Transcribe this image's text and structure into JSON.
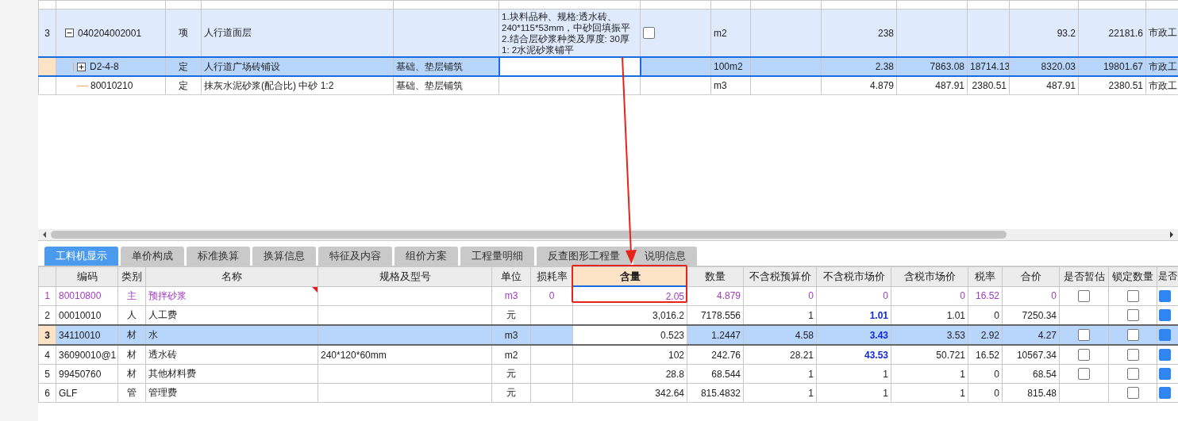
{
  "top_table": {
    "rows": [
      {
        "row_number": "3",
        "code": "040204002001",
        "expanded": true,
        "selected": false,
        "column_3": "项",
        "column_4": "人行道面层",
        "column_6": "1.块料品种、规格:透水砖、\n240*115*53mm，中砂回填振平\n2.结合层砂浆种类及厚度: 30厚\n1: 2水泥砂浆铺平",
        "column_7": {
          "checked": false
        },
        "column_8": "m2",
        "column_10": "238",
        "column_13": "93.2",
        "column_14": "22181.6",
        "column_15": "市政工",
        "children": [
          {
            "code": "D2-4-8",
            "expanded": false,
            "selected": true,
            "column_3": "定",
            "column_4": "人行道广场砖铺设",
            "column_5": "基础、垫层铺筑",
            "column_8": "100m2",
            "column_10": "2.38",
            "column_11": "7863.08",
            "column_12": "18714.13",
            "column_13": "8320.03",
            "column_14": "19801.67",
            "column_15": "市政工"
          },
          {
            "code": "80010210",
            "selected": false,
            "column_3": "定",
            "column_4": "抹灰水泥砂浆(配合比) 中砂 1:2",
            "column_5": "基础、垫层铺筑",
            "column_8": "m3",
            "column_10": "4.879",
            "column_11": "487.91",
            "column_12": "2380.51",
            "column_13": "487.91",
            "column_14": "2380.51",
            "column_15": "市政工"
          }
        ]
      }
    ]
  },
  "tabs": [
    {
      "label": "工料机显示",
      "selected": true
    },
    {
      "label": "单价构成",
      "selected": false
    },
    {
      "label": "标准换算",
      "selected": false
    },
    {
      "label": "换算信息",
      "selected": false
    },
    {
      "label": "特征及内容",
      "selected": false
    },
    {
      "label": "组价方案",
      "selected": false
    },
    {
      "label": "工程量明细",
      "selected": false
    },
    {
      "label": "反查图形工程量",
      "selected": false
    },
    {
      "label": "说明信息",
      "selected": false
    }
  ],
  "resource_table": {
    "columns": [
      {
        "label": "编码",
        "active": false
      },
      {
        "label": "类别",
        "active": false
      },
      {
        "label": "名称",
        "active": false
      },
      {
        "label": "规格及型号",
        "active": false
      },
      {
        "label": "单位",
        "active": false
      },
      {
        "label": "损耗率",
        "active": false
      },
      {
        "label": "含量",
        "active": true
      },
      {
        "label": "数量",
        "active": false
      },
      {
        "label": "不含税预算价",
        "active": false
      },
      {
        "label": "不含税市场价",
        "active": false
      },
      {
        "label": "含税市场价",
        "active": false
      },
      {
        "label": "税率",
        "active": false
      },
      {
        "label": "合价",
        "active": false
      },
      {
        "label": "是否暂估",
        "active": false
      },
      {
        "label": "锁定数量",
        "active": false
      },
      {
        "label": "是否",
        "active": false
      }
    ],
    "rows": [
      {
        "row_number": "1",
        "kind": "main",
        "selected": false,
        "note_marker": true,
        "market_price_changed": false,
        "cells": [
          "80010800",
          "主",
          "预拌砂浆",
          null,
          "m3",
          "0",
          "2.05",
          "4.879",
          "0",
          "0",
          "0",
          "16.52",
          "0"
        ],
        "estimate": {
          "checked": false
        },
        "lock": {
          "checked": false
        },
        "last": {
          "checked": true
        }
      },
      {
        "row_number": "2",
        "kind": "normal",
        "selected": false,
        "note_marker": false,
        "market_price_changed": true,
        "cells": [
          "00010010",
          "人",
          "人工费",
          null,
          "元",
          null,
          "3,016.2",
          "7178.556",
          "1",
          "1.01",
          "1.01",
          "0",
          "7250.34"
        ],
        "lock": {
          "checked": false
        },
        "last": {
          "checked": true
        }
      },
      {
        "row_number": "3",
        "kind": "normal",
        "selected": true,
        "note_marker": false,
        "market_price_changed": true,
        "cells": [
          "34110010",
          "材",
          "水",
          null,
          "m3",
          null,
          "0.523",
          "1.2447",
          "4.58",
          "3.43",
          "3.53",
          "2.92",
          "4.27"
        ],
        "estimate": {
          "checked": false
        },
        "lock": {
          "checked": false
        },
        "last": {
          "checked": true
        }
      },
      {
        "row_number": "4",
        "kind": "normal",
        "selected": false,
        "note_marker": false,
        "market_price_changed": true,
        "cells": [
          "36090010@1",
          "材",
          "透水砖",
          "240*120*60mm",
          "m2",
          null,
          "102",
          "242.76",
          "28.21",
          "43.53",
          "50.721",
          "16.52",
          "10567.34"
        ],
        "estimate": {
          "checked": false
        },
        "lock": {
          "checked": false
        },
        "last": {
          "checked": true
        }
      },
      {
        "row_number": "5",
        "kind": "normal",
        "selected": false,
        "note_marker": false,
        "market_price_changed": false,
        "cells": [
          "99450760",
          "材",
          "其他材料费",
          null,
          "元",
          null,
          "28.8",
          "68.544",
          "1",
          "1",
          "1",
          "0",
          "68.54"
        ],
        "estimate": {
          "checked": false
        },
        "lock": {
          "checked": false
        },
        "last": {
          "checked": true
        }
      },
      {
        "row_number": "6",
        "kind": "normal",
        "selected": false,
        "note_marker": false,
        "market_price_changed": false,
        "cells": [
          "GLF",
          "管",
          "管理费",
          null,
          "元",
          null,
          "342.64",
          "815.4832",
          "1",
          "1",
          "1",
          "0",
          "815.48"
        ],
        "lock": {
          "checked": false
        },
        "last": {
          "checked": true
        }
      }
    ]
  }
}
